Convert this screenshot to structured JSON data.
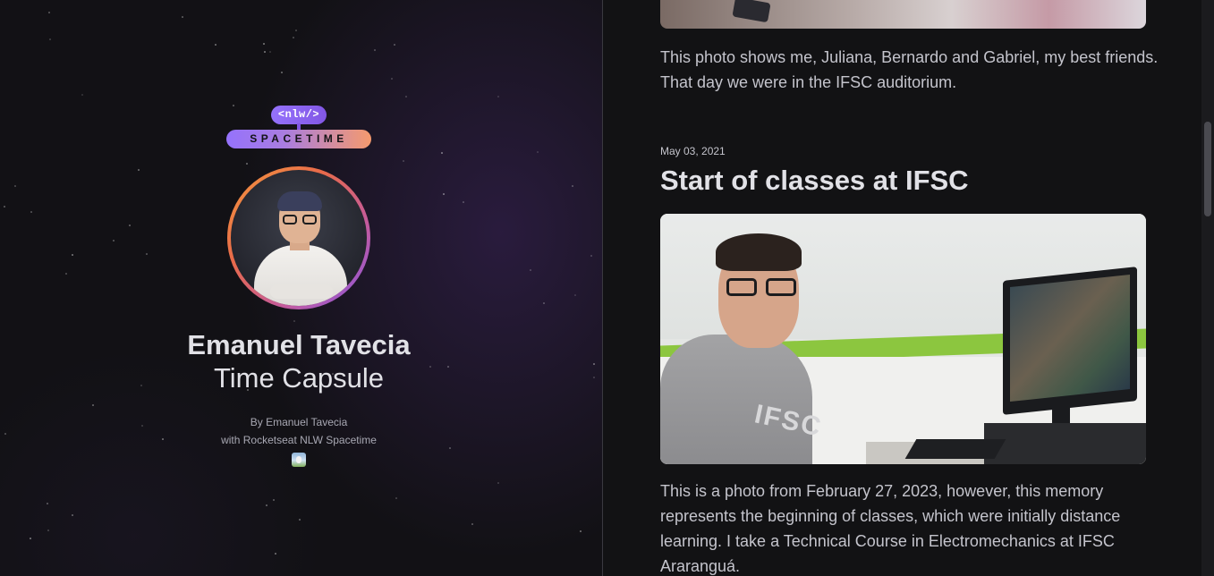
{
  "profile": {
    "logo_top": "<nlw/>",
    "logo_bottom": "SPACETIME",
    "name": "Emanuel Tavecia",
    "subtitle": "Time Capsule",
    "credit_by": "By Emanuel Tavecia",
    "credit_with": "with Rocketseat NLW Spacetime"
  },
  "memories": {
    "previous": {
      "caption": "This photo shows me, Juliana, Bernardo and Gabriel, my best friends. That day we were in the IFSC auditorium."
    },
    "current": {
      "date": "May 03, 2021",
      "title": "Start of classes at IFSC",
      "hoodie_text": "IFSC",
      "caption": "This is a photo from February 27, 2023, however, this memory represents the beginning of classes, which were initially distance learning. I take a Technical Course in Electromechanics at IFSC Araranguá."
    }
  },
  "icons": {
    "emoji": "snowman-emoji-icon"
  },
  "colors": {
    "background": "#121214",
    "accent_purple": "#8257e5",
    "accent_orange": "#f59a3d",
    "text": "#e1e1e6"
  }
}
